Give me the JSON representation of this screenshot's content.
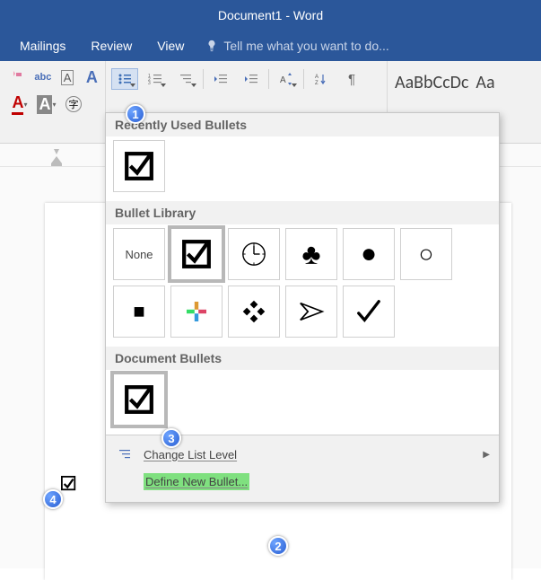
{
  "title_bar": {
    "text": "Document1 - Word"
  },
  "tabs": {
    "mailings": "Mailings",
    "review": "Review",
    "view": "View",
    "tellme_placeholder": "Tell me what you want to do..."
  },
  "styles": {
    "normal_preview": "AaBbCcDc",
    "heading_preview": "Aa"
  },
  "dropdown": {
    "recently_used_heading": "Recently Used Bullets",
    "bullet_library_heading": "Bullet Library",
    "document_bullets_heading": "Document Bullets",
    "none_label": "None",
    "change_list_level": "Change List Level",
    "define_new_bullet": "Define New Bullet..."
  },
  "callouts": {
    "c1": "1",
    "c2": "2",
    "c3": "3",
    "c4": "4"
  }
}
